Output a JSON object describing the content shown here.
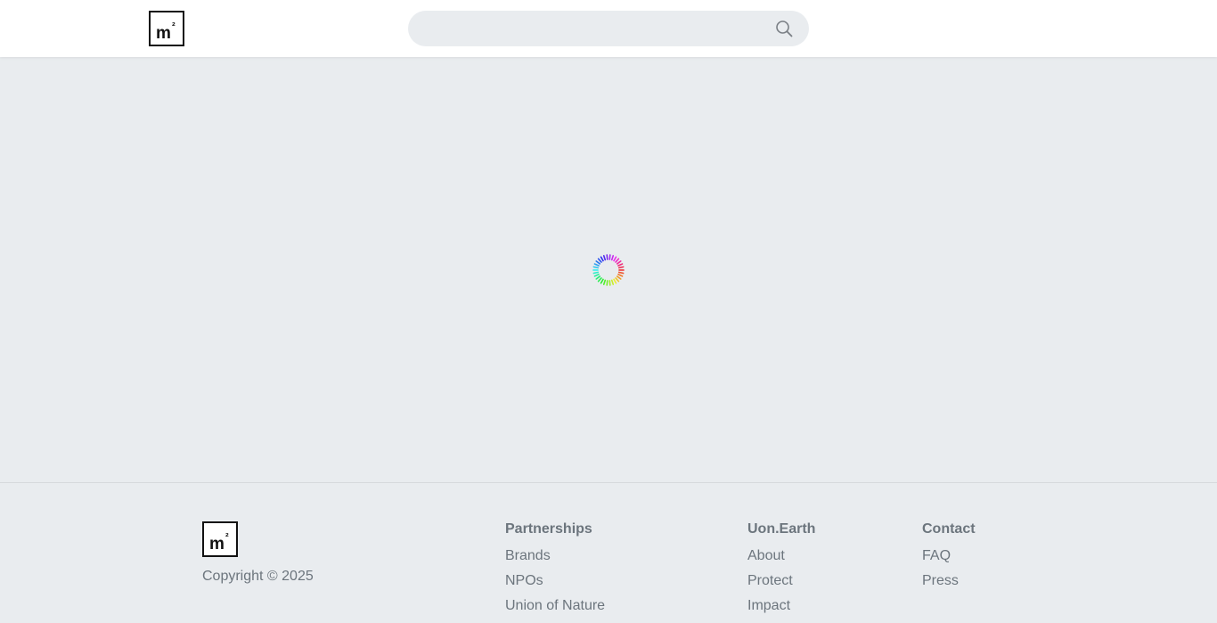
{
  "header": {
    "logo": {
      "main": "m",
      "superscript": "²"
    },
    "search": {
      "value": "",
      "placeholder": ""
    }
  },
  "main": {
    "loading_indicator": "spinner-icon"
  },
  "footer": {
    "logo": {
      "main": "m",
      "superscript": "²"
    },
    "copyright": "Copyright © 2025",
    "columns": [
      {
        "heading": "Partnerships",
        "links": [
          "Brands",
          "NPOs",
          "Union of Nature"
        ]
      },
      {
        "heading": "Uon.Earth",
        "links": [
          "About",
          "Protect",
          "Impact"
        ]
      },
      {
        "heading": "Contact",
        "links": [
          "FAQ",
          "Press"
        ]
      }
    ]
  },
  "colors": {
    "background": "#e9ecef",
    "header_background": "#ffffff",
    "text_muted": "#6c757d",
    "logo_border": "#111111"
  }
}
